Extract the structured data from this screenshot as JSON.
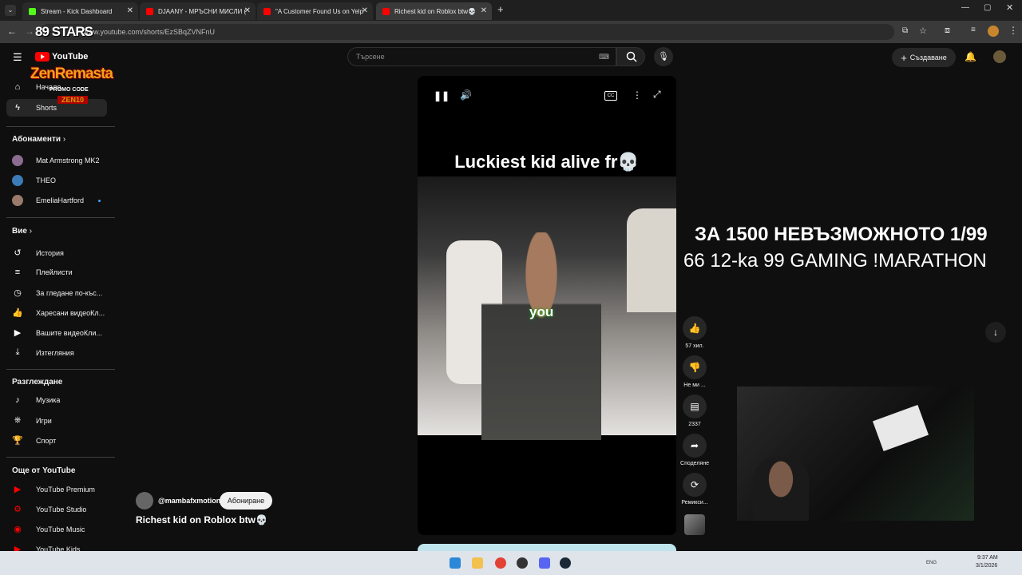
{
  "browser": {
    "tabs": [
      {
        "label": "Stream - Kick Dashboard",
        "color": "#53fc18"
      },
      {
        "label": "DJAANY - МРЪСНИ МИСЛИ (",
        "color": "#ff0000"
      },
      {
        "label": "\"A Customer Found Us on Yelp",
        "color": "#ff0000"
      },
      {
        "label": "Richest kid on Roblox btw💀",
        "color": "#ff0000"
      }
    ],
    "url": "www.youtube.com/shorts/EzSBqZVNFnU"
  },
  "youtube": {
    "logo": "YouTube",
    "search_placeholder": "Търсене",
    "create_label": "Създаване",
    "sidebar": {
      "main": [
        "Начало",
        "Shorts"
      ],
      "subs_heading": "Абонаменти",
      "subscriptions": [
        "Mat Armstrong MK2",
        "THEO",
        "EmeliaHartford"
      ],
      "you_heading": "Вие",
      "you_items": [
        "История",
        "Плейлисти",
        "За гледане по-къс...",
        "Харесани видеоКл...",
        "Вашите видеоКли...",
        "Изтегляния"
      ],
      "explore_heading": "Разглеждане",
      "explore_items": [
        "Музика",
        "Игри",
        "Спорт"
      ],
      "more_heading": "Още от YouTube",
      "more_items": [
        "YouTube Premium",
        "YouTube Studio",
        "YouTube Music",
        "YouTube Kids"
      ]
    },
    "short": {
      "caption": "Luckiest kid alive fr💀",
      "subtitle_word": "you",
      "channel": "@mambafxmotion",
      "subscribe": "Абониране",
      "title": "Richest kid on Roblox btw💀"
    },
    "actions": {
      "likes": "57 хил.",
      "dislike": "Не ми ...",
      "comments": "2337",
      "share": "Споделяне",
      "remix": "Ремикси..."
    }
  },
  "overlay": {
    "stars": "89 STARS",
    "brand": "ZenRemasta",
    "promo_label": "PROMO CODE",
    "promo_code": "ZEN10",
    "line1": "ЗА 1500 НЕВЪЗМОЖНОТО 1/99",
    "line2": "66 12-ka 99 GAMING !MARATHON"
  },
  "taskbar": {
    "time": "9:37 AM",
    "date": "3/1/2026",
    "lang": "ENG"
  }
}
